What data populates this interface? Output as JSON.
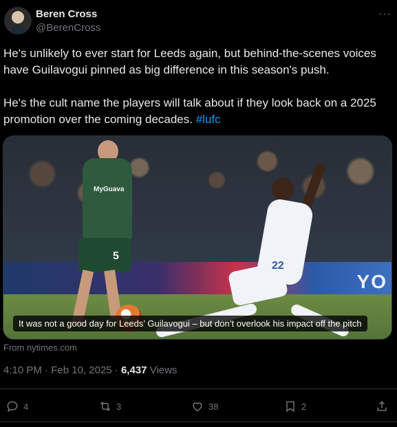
{
  "author": {
    "name": "Beren Cross",
    "handle": "@BerenCross"
  },
  "more_label": "···",
  "tweet": {
    "paragraph1": "He's unlikely to ever start for Leeds again, but behind-the-scenes voices have Guilavogui pinned as big difference in this season's push.",
    "paragraph2_text": "He's the cult name the players will talk about if they look back on a 2025 promotion over the coming decades. ",
    "hashtag": "#lufc"
  },
  "media": {
    "caption": "It was not a good day for Leeds’ Guilavogui – but don’t overlook his impact off the pitch",
    "sponsor_text": "MyGuava",
    "green_number": "5",
    "white_number": "22",
    "hoarding_text": "YO"
  },
  "source": "From nytimes.com",
  "meta": {
    "time": "4:10 PM",
    "separator": "·",
    "date": "Feb 10, 2025",
    "views_count": "6,437",
    "views_label": "Views"
  },
  "actions": {
    "reply_count": "4",
    "repost_count": "3",
    "like_count": "38",
    "bookmark_count": "2"
  },
  "colors": {
    "background": "#000000",
    "text": "#e7e9ea",
    "muted": "#71767b",
    "link": "#1d9bf0",
    "divider": "#2f3336"
  }
}
